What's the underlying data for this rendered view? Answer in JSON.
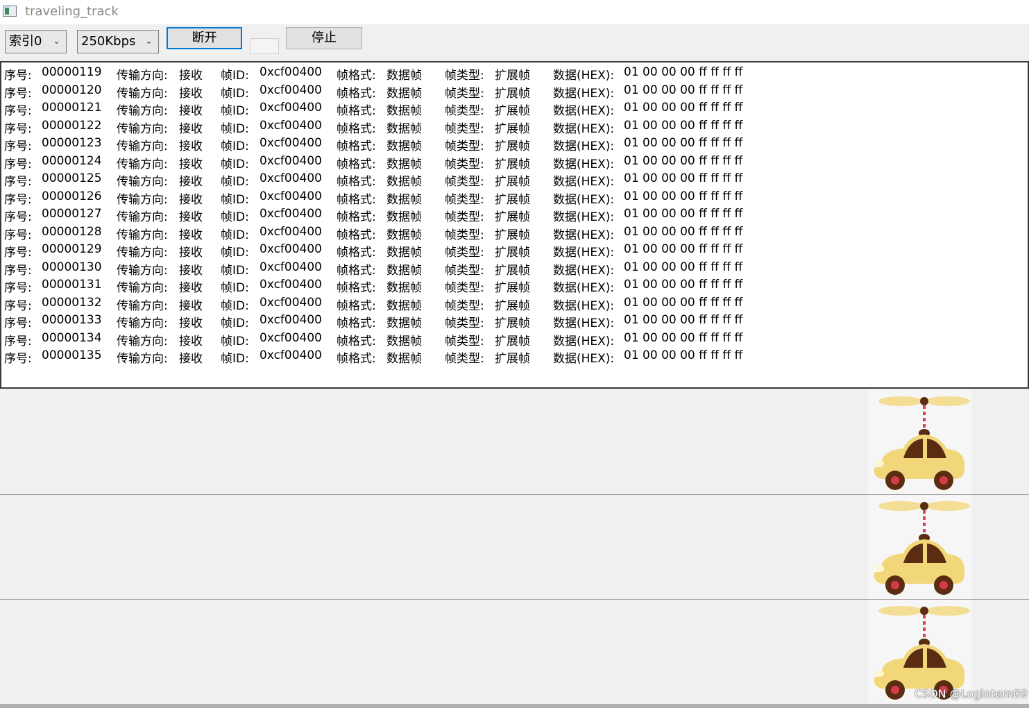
{
  "window": {
    "title": "traveling_track"
  },
  "toolbar": {
    "index_select": "索引0",
    "baud_select": "250Kbps",
    "disconnect_label": "断开",
    "stop_label": "停止"
  },
  "log": {
    "rows": [
      {
        "seq_label": "序号:",
        "seq": "00000119",
        "dir_label": "传输方向:",
        "dir": "接收",
        "id_label": "帧ID:",
        "id": "0xcf00400",
        "fmt_label": "帧格式:",
        "fmt": "数据帧",
        "type_label": "帧类型:",
        "type": "扩展帧",
        "data_label": "数据(HEX):",
        "data": "01 00 00 00 ff ff ff ff"
      },
      {
        "seq_label": "序号:",
        "seq": "00000120",
        "dir_label": "传输方向:",
        "dir": "接收",
        "id_label": "帧ID:",
        "id": "0xcf00400",
        "fmt_label": "帧格式:",
        "fmt": "数据帧",
        "type_label": "帧类型:",
        "type": "扩展帧",
        "data_label": "数据(HEX):",
        "data": "01 00 00 00 ff ff ff ff"
      },
      {
        "seq_label": "序号:",
        "seq": "00000121",
        "dir_label": "传输方向:",
        "dir": "接收",
        "id_label": "帧ID:",
        "id": "0xcf00400",
        "fmt_label": "帧格式:",
        "fmt": "数据帧",
        "type_label": "帧类型:",
        "type": "扩展帧",
        "data_label": "数据(HEX):",
        "data": "01 00 00 00 ff ff ff ff"
      },
      {
        "seq_label": "序号:",
        "seq": "00000122",
        "dir_label": "传输方向:",
        "dir": "接收",
        "id_label": "帧ID:",
        "id": "0xcf00400",
        "fmt_label": "帧格式:",
        "fmt": "数据帧",
        "type_label": "帧类型:",
        "type": "扩展帧",
        "data_label": "数据(HEX):",
        "data": "01 00 00 00 ff ff ff ff"
      },
      {
        "seq_label": "序号:",
        "seq": "00000123",
        "dir_label": "传输方向:",
        "dir": "接收",
        "id_label": "帧ID:",
        "id": "0xcf00400",
        "fmt_label": "帧格式:",
        "fmt": "数据帧",
        "type_label": "帧类型:",
        "type": "扩展帧",
        "data_label": "数据(HEX):",
        "data": "01 00 00 00 ff ff ff ff"
      },
      {
        "seq_label": "序号:",
        "seq": "00000124",
        "dir_label": "传输方向:",
        "dir": "接收",
        "id_label": "帧ID:",
        "id": "0xcf00400",
        "fmt_label": "帧格式:",
        "fmt": "数据帧",
        "type_label": "帧类型:",
        "type": "扩展帧",
        "data_label": "数据(HEX):",
        "data": "01 00 00 00 ff ff ff ff"
      },
      {
        "seq_label": "序号:",
        "seq": "00000125",
        "dir_label": "传输方向:",
        "dir": "接收",
        "id_label": "帧ID:",
        "id": "0xcf00400",
        "fmt_label": "帧格式:",
        "fmt": "数据帧",
        "type_label": "帧类型:",
        "type": "扩展帧",
        "data_label": "数据(HEX):",
        "data": "01 00 00 00 ff ff ff ff"
      },
      {
        "seq_label": "序号:",
        "seq": "00000126",
        "dir_label": "传输方向:",
        "dir": "接收",
        "id_label": "帧ID:",
        "id": "0xcf00400",
        "fmt_label": "帧格式:",
        "fmt": "数据帧",
        "type_label": "帧类型:",
        "type": "扩展帧",
        "data_label": "数据(HEX):",
        "data": "01 00 00 00 ff ff ff ff"
      },
      {
        "seq_label": "序号:",
        "seq": "00000127",
        "dir_label": "传输方向:",
        "dir": "接收",
        "id_label": "帧ID:",
        "id": "0xcf00400",
        "fmt_label": "帧格式:",
        "fmt": "数据帧",
        "type_label": "帧类型:",
        "type": "扩展帧",
        "data_label": "数据(HEX):",
        "data": "01 00 00 00 ff ff ff ff"
      },
      {
        "seq_label": "序号:",
        "seq": "00000128",
        "dir_label": "传输方向:",
        "dir": "接收",
        "id_label": "帧ID:",
        "id": "0xcf00400",
        "fmt_label": "帧格式:",
        "fmt": "数据帧",
        "type_label": "帧类型:",
        "type": "扩展帧",
        "data_label": "数据(HEX):",
        "data": "01 00 00 00 ff ff ff ff"
      },
      {
        "seq_label": "序号:",
        "seq": "00000129",
        "dir_label": "传输方向:",
        "dir": "接收",
        "id_label": "帧ID:",
        "id": "0xcf00400",
        "fmt_label": "帧格式:",
        "fmt": "数据帧",
        "type_label": "帧类型:",
        "type": "扩展帧",
        "data_label": "数据(HEX):",
        "data": "01 00 00 00 ff ff ff ff"
      },
      {
        "seq_label": "序号:",
        "seq": "00000130",
        "dir_label": "传输方向:",
        "dir": "接收",
        "id_label": "帧ID:",
        "id": "0xcf00400",
        "fmt_label": "帧格式:",
        "fmt": "数据帧",
        "type_label": "帧类型:",
        "type": "扩展帧",
        "data_label": "数据(HEX):",
        "data": "01 00 00 00 ff ff ff ff"
      },
      {
        "seq_label": "序号:",
        "seq": "00000131",
        "dir_label": "传输方向:",
        "dir": "接收",
        "id_label": "帧ID:",
        "id": "0xcf00400",
        "fmt_label": "帧格式:",
        "fmt": "数据帧",
        "type_label": "帧类型:",
        "type": "扩展帧",
        "data_label": "数据(HEX):",
        "data": "01 00 00 00 ff ff ff ff"
      },
      {
        "seq_label": "序号:",
        "seq": "00000132",
        "dir_label": "传输方向:",
        "dir": "接收",
        "id_label": "帧ID:",
        "id": "0xcf00400",
        "fmt_label": "帧格式:",
        "fmt": "数据帧",
        "type_label": "帧类型:",
        "type": "扩展帧",
        "data_label": "数据(HEX):",
        "data": "01 00 00 00 ff ff ff ff"
      },
      {
        "seq_label": "序号:",
        "seq": "00000133",
        "dir_label": "传输方向:",
        "dir": "接收",
        "id_label": "帧ID:",
        "id": "0xcf00400",
        "fmt_label": "帧格式:",
        "fmt": "数据帧",
        "type_label": "帧类型:",
        "type": "扩展帧",
        "data_label": "数据(HEX):",
        "data": "01 00 00 00 ff ff ff ff"
      },
      {
        "seq_label": "序号:",
        "seq": "00000134",
        "dir_label": "传输方向:",
        "dir": "接收",
        "id_label": "帧ID:",
        "id": "0xcf00400",
        "fmt_label": "帧格式:",
        "fmt": "数据帧",
        "type_label": "帧类型:",
        "type": "扩展帧",
        "data_label": "数据(HEX):",
        "data": "01 00 00 00 ff ff ff ff"
      },
      {
        "seq_label": "序号:",
        "seq": "00000135",
        "dir_label": "传输方向:",
        "dir": "接收",
        "id_label": "帧ID:",
        "id": "0xcf00400",
        "fmt_label": "帧格式:",
        "fmt": "数据帧",
        "type_label": "帧类型:",
        "type": "扩展帧",
        "data_label": "数据(HEX):",
        "data": "01 00 00 00 ff ff ff ff"
      }
    ]
  },
  "tracks": {
    "icon": "flying-car-icon",
    "count": 3,
    "colors": {
      "body": "#f2d77a",
      "window": "#5a2d12",
      "propeller": "#f4de96",
      "wheel_hub": "#d83a4a",
      "pole": "#e04050"
    }
  },
  "watermark": "CSDN @Logintern09"
}
